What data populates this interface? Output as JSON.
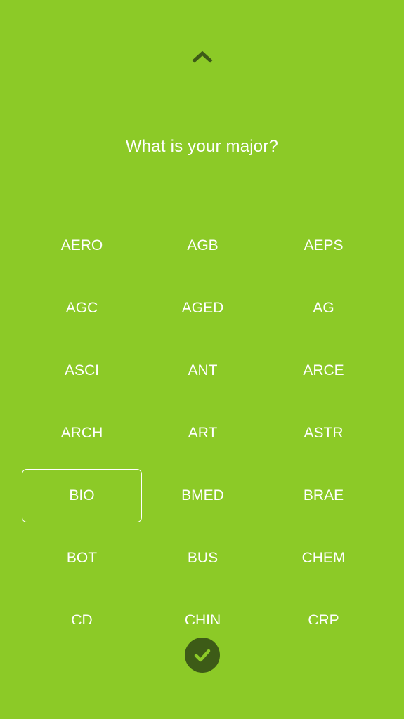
{
  "header": {
    "collapse_icon": "chevron-up-icon",
    "question": "What is your major?"
  },
  "majors": {
    "selected": "BIO",
    "rows": [
      [
        "AERO",
        "AGB",
        "AEPS"
      ],
      [
        "AGC",
        "AGED",
        "AG"
      ],
      [
        "ASCI",
        "ANT",
        "ARCE"
      ],
      [
        "ARCH",
        "ART",
        "ASTR"
      ],
      [
        "BIO",
        "BMED",
        "BRAE"
      ],
      [
        "BOT",
        "BUS",
        "CHEM"
      ],
      [
        "CD",
        "CHIN",
        "CRP"
      ]
    ]
  },
  "footer": {
    "confirm_icon": "checkmark-icon"
  },
  "colors": {
    "background": "#8cca27",
    "accent_dark": "#3d5b17",
    "text": "#ffffff"
  }
}
